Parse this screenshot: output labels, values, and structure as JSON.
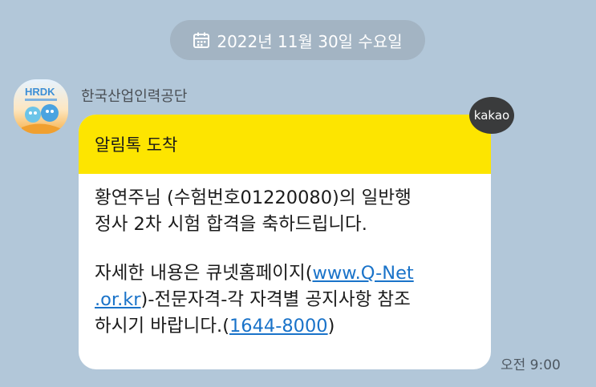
{
  "date_divider": {
    "icon": "calendar-icon",
    "label": "2022년 11월 30일 수요일"
  },
  "message": {
    "sender": "한국산업인력공단",
    "avatar_text": "HRDK",
    "badge": "kakao",
    "header": "알림톡 도착",
    "body": {
      "line1": "황연주님 (수험번호01220080)의 일반행",
      "line2": "정사 2차 시험 합격을 축하드립니다.",
      "line3_prefix": "자세한 내용은 큐넷홈페이지(",
      "link_url_part1": "www.Q-Net",
      "link_url_part2": ".or.kr",
      "line4_suffix": ")-전문자격-각 자격별 공지사항 참조",
      "line5_prefix": "하시기 바랍니다.(",
      "phone": "1644-8000",
      "line5_suffix": ")"
    },
    "time": "오전 9:00"
  },
  "colors": {
    "background": "#b2c7d9",
    "header_yellow": "#fde500",
    "link_blue": "#1a73c9"
  }
}
